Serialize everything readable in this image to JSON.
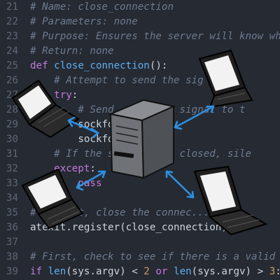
{
  "editor": {
    "lines": [
      {
        "num": "21",
        "text": "# Name: close_connection",
        "kind": "comment"
      },
      {
        "num": "22",
        "text": "# Parameters: none",
        "kind": "comment"
      },
      {
        "num": "23",
        "text": "# Purpose: Ensures the server will know whe",
        "kind": "comment"
      },
      {
        "num": "24",
        "text": "# Return: none",
        "kind": "comment"
      },
      {
        "num": "25",
        "text": "def close_connection():",
        "kind": "def"
      },
      {
        "num": "26",
        "text": "    # Attempt to send the sig",
        "kind": "comment"
      },
      {
        "num": "27",
        "text": "    try:",
        "kind": "keyword"
      },
      {
        "num": "28",
        "text": "        # Send ...iation signal to t",
        "kind": "comment"
      },
      {
        "num": "29",
        "text": "        sockfd...",
        "kind": "code"
      },
      {
        "num": "30",
        "text": "        sockfd",
        "kind": "code"
      },
      {
        "num": "31",
        "text": "    # If the s...already closed, sile",
        "kind": "comment"
      },
      {
        "num": "32",
        "text": "    except:",
        "kind": "keyword"
      },
      {
        "num": "33",
        "text": "        pass",
        "kind": "keyword"
      },
      {
        "num": "34",
        "text": "",
        "kind": "blank"
      },
      {
        "num": "35",
        "text": "# ...exit, close the connec...",
        "kind": "comment"
      },
      {
        "num": "36",
        "text": "atexit.register(close_connection)",
        "kind": "code"
      },
      {
        "num": "37",
        "text": "",
        "kind": "blank"
      },
      {
        "num": "38",
        "text": "# First, check to see if there is a valid n",
        "kind": "comment"
      },
      {
        "num": "39",
        "text": "if len(sys.argv) < 2 or len(sys.argv) > 3:",
        "kind": "if"
      }
    ],
    "fragments": {
      "str_fragment": "\"",
      "def_kw": "def",
      "def_name": "close_connection",
      "def_rest": "():",
      "if_kw": "if",
      "len_fn": "len",
      "or_kw": "or",
      "num_two": "2",
      "num_three": "3"
    }
  },
  "illustration": {
    "nodes": [
      "server-icon",
      "laptop-icon",
      "laptop-icon",
      "laptop-icon",
      "laptop-icon"
    ],
    "colors": {
      "arrow": "#2f8fe0",
      "server": "#6b6e73",
      "laptop": "#1f1f1f",
      "screen": "#f2f2f2"
    }
  }
}
